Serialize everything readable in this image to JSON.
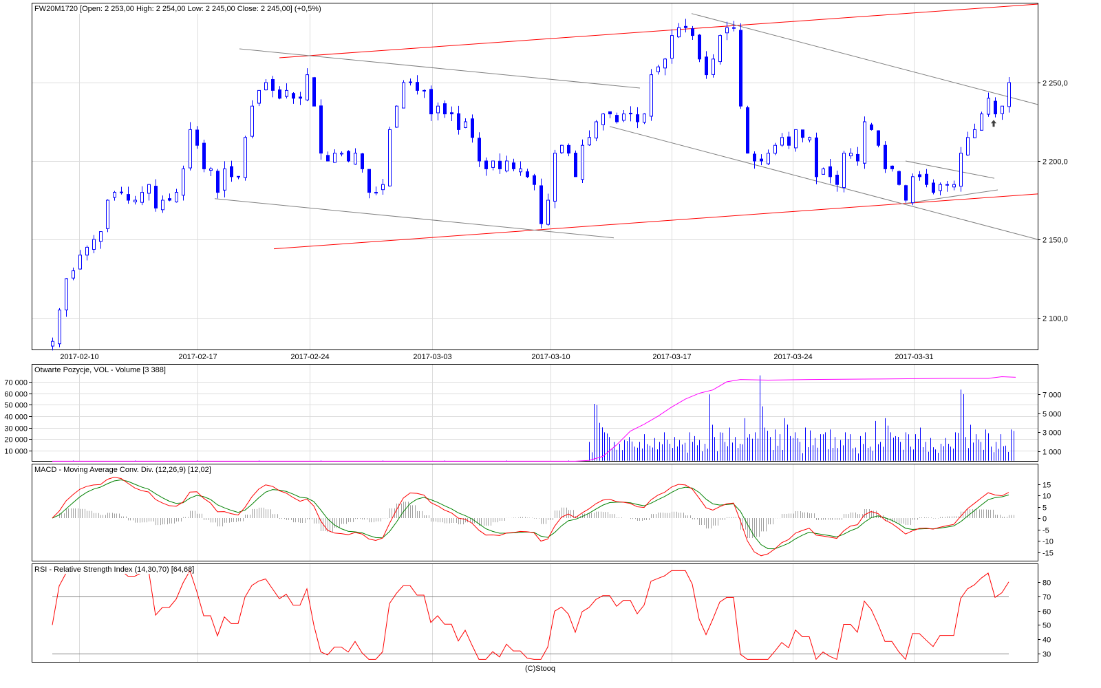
{
  "header": {
    "title": "FW20M1720 [Open: 2 253,00  High: 2 254,00  Low: 2 245,00  Close: 2 245,00] (+0,5%)"
  },
  "footer": "(C)Stooq",
  "colors": {
    "candle": "#0000ff",
    "trend_red": "#ff0000",
    "trend_gray": "#808080",
    "oi": "#ff00ff",
    "macd": "#ff0000",
    "signal": "#008000",
    "hist": "#a0a0a0",
    "rsi": "#ff0000"
  },
  "chart_data": [
    {
      "type": "candlestick",
      "title": "FW20M1720",
      "x_ticks": [
        {
          "label": "2017-02-10",
          "i": 3.9
        },
        {
          "label": "2017-02-17",
          "i": 21.1
        },
        {
          "label": "2017-02-24",
          "i": 37.4
        },
        {
          "label": "2017-03-03",
          "i": 55.2
        },
        {
          "label": "2017-03-10",
          "i": 72.4
        },
        {
          "label": "2017-03-17",
          "i": 90
        },
        {
          "label": "2017-03-24",
          "i": 107.6
        },
        {
          "label": "2017-03-31",
          "i": 125.2
        }
      ],
      "y_ticks": [
        {
          "label": "2 250,0",
          "v": 2250
        },
        {
          "label": "2 200,0",
          "v": 2200
        },
        {
          "label": "2 150,0",
          "v": 2150
        },
        {
          "label": "2 100,0",
          "v": 2100
        }
      ],
      "ylim": [
        2080,
        2301
      ],
      "closes": [
        2085,
        2105,
        2125,
        2130,
        2140,
        2145,
        2150,
        2155,
        2175,
        2180,
        2180,
        2175,
        2175,
        2180,
        2185,
        2170,
        2175,
        2175,
        2180,
        2195,
        2220,
        2210,
        2195,
        2195,
        2180,
        2195,
        2190,
        2190,
        2215,
        2235,
        2245,
        2250,
        2245,
        2240,
        2245,
        2240,
        2240,
        2255,
        2235,
        2205,
        2200,
        2205,
        2205,
        2200,
        2205,
        2195,
        2180,
        2180,
        2185,
        2220,
        2235,
        2250,
        2250,
        2245,
        2245,
        2230,
        2235,
        2230,
        2230,
        2220,
        2225,
        2215,
        2200,
        2195,
        2200,
        2195,
        2200,
        2195,
        2195,
        2190,
        2185,
        2160,
        2175,
        2205,
        2210,
        2205,
        2190,
        2210,
        2215,
        2225,
        2230,
        2230,
        2225,
        2230,
        2230,
        2225,
        2230,
        2255,
        2260,
        2265,
        2280,
        2285,
        2285,
        2280,
        2265,
        2255,
        2265,
        2280,
        2285,
        2285,
        2235,
        2205,
        2200,
        2200,
        2205,
        2210,
        2215,
        2210,
        2220,
        2215,
        2215,
        2190,
        2195,
        2190,
        2185,
        2205,
        2205,
        2200,
        2225,
        2220,
        2210,
        2195,
        2195,
        2185,
        2175,
        2190,
        2190,
        2185,
        2180,
        2185,
        2185,
        2185,
        2205,
        2215,
        2220,
        2230,
        2240,
        2230,
        2235,
        2250
      ],
      "trendlines": [
        {
          "color": "red",
          "from": [
            33,
            2265.8
          ],
          "to": [
            143.2,
            2300
          ]
        },
        {
          "color": "red",
          "from": [
            32.2,
            2144
          ],
          "to": [
            143.2,
            2179
          ]
        },
        {
          "color": "gray",
          "from": [
            27.2,
            2271.5
          ],
          "to": [
            85.4,
            2246.5
          ]
        },
        {
          "color": "gray",
          "from": [
            23.6,
            2176
          ],
          "to": [
            81.6,
            2151
          ]
        },
        {
          "color": "gray",
          "from": [
            92.9,
            2294
          ],
          "to": [
            143.2,
            2236
          ]
        },
        {
          "color": "gray",
          "from": [
            81,
            2222
          ],
          "to": [
            143.2,
            2150
          ]
        },
        {
          "color": "gray",
          "from": [
            124,
            2200
          ],
          "to": [
            136.9,
            2189
          ]
        },
        {
          "color": "gray",
          "from": [
            124,
            2173
          ],
          "to": [
            137.4,
            2181.6
          ]
        }
      ],
      "marker": {
        "type": "arrow-up",
        "i": 136.8,
        "v": 2224
      }
    },
    {
      "type": "bar+line",
      "title": "Otwarte Pozycje, VOL - Volume [3 388]",
      "left_ticks": [
        {
          "label": "70 000",
          "v": 70000
        },
        {
          "label": "60 000",
          "v": 60000
        },
        {
          "label": "50 000",
          "v": 50000
        },
        {
          "label": "40 000",
          "v": 40000
        },
        {
          "label": "30 000",
          "v": 30000
        },
        {
          "label": "20 000",
          "v": 20000
        },
        {
          "label": "10 000",
          "v": 10000
        }
      ],
      "right_ticks": [
        {
          "label": "7 000",
          "v": 7000
        },
        {
          "label": "5 000",
          "v": 5000
        },
        {
          "label": "3 000",
          "v": 3000
        },
        {
          "label": "1 000",
          "v": 1000
        }
      ],
      "volume_start": 78,
      "volume": [
        2000,
        6000,
        4000,
        3000,
        2500,
        2000,
        1800,
        2200,
        2500,
        1500,
        2000,
        2800,
        1600,
        2400,
        2000,
        3000,
        1800,
        2500,
        2200,
        1900,
        3000,
        2600,
        2200,
        1800,
        7000,
        2500,
        3000,
        2000,
        3500,
        2500,
        1800,
        4500,
        2800,
        3000,
        9000,
        3500,
        2500,
        3300,
        2800,
        4500,
        2600,
        3000,
        2000,
        3500,
        3200,
        2400,
        2800,
        3000,
        3300,
        2500,
        2200,
        3000,
        2800,
        1400,
        2600,
        3000,
        1500,
        4200,
        2000,
        4500,
        3000,
        2600,
        2000,
        3000,
        1500,
        2800,
        3500,
        2000,
        2400,
        1200,
        1800,
        2400,
        1500,
        3000,
        7500,
        2500,
        3800,
        2800,
        2000,
        3300,
        1500,
        2000,
        2800,
        1600,
        3300
      ],
      "oi_points": [
        [
          0,
          800
        ],
        [
          76,
          800
        ],
        [
          78,
          1500
        ],
        [
          80,
          5000
        ],
        [
          82,
          15000
        ],
        [
          84,
          27000
        ],
        [
          86,
          33000
        ],
        [
          88,
          40000
        ],
        [
          90,
          48000
        ],
        [
          92,
          55000
        ],
        [
          94,
          60000
        ],
        [
          96,
          63000
        ],
        [
          98,
          70000
        ],
        [
          100,
          72000
        ],
        [
          104,
          71500
        ],
        [
          110,
          72000
        ],
        [
          120,
          72500
        ],
        [
          130,
          73000
        ],
        [
          136,
          73000
        ],
        [
          138,
          74500
        ],
        [
          140,
          74000
        ]
      ]
    },
    {
      "type": "line",
      "title": "MACD - Moving Average Conv. Div. (12,26,9) [12,02]",
      "ticks": [
        {
          "label": "15",
          "v": 15
        },
        {
          "label": "10",
          "v": 10
        },
        {
          "label": "5",
          "v": 5
        },
        {
          "label": "0",
          "v": 0
        },
        {
          "label": "-5",
          "v": -5
        },
        {
          "label": "-10",
          "v": -10
        },
        {
          "label": "-15",
          "v": -15
        }
      ],
      "params": [
        12,
        26,
        9
      ],
      "last": 12.02
    },
    {
      "type": "line",
      "title": "RSI - Relative Strength Index (14,30,70) [64,68]",
      "ticks": [
        {
          "label": "80",
          "v": 80
        },
        {
          "label": "70",
          "v": 70
        },
        {
          "label": "60",
          "v": 60
        },
        {
          "label": "50",
          "v": 50
        },
        {
          "label": "40",
          "v": 40
        },
        {
          "label": "30",
          "v": 30
        }
      ],
      "levels": [
        30,
        70
      ],
      "period": 14,
      "last": 64.68
    }
  ]
}
